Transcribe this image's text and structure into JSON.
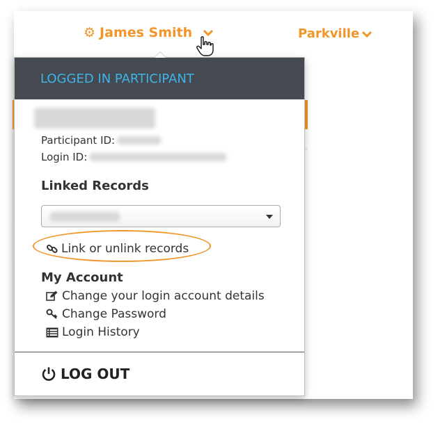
{
  "nav": {
    "user_name": "James Smith",
    "location": "Parkville"
  },
  "dropdown": {
    "header": "LOGGED IN PARTICIPANT",
    "participant_id_label": "Participant ID:",
    "login_id_label": "Login ID:",
    "linked_records_title": "Linked Records",
    "link_records_label": "Link or unlink records",
    "my_account_title": "My Account",
    "account_links": {
      "change_details": "Change your login account details",
      "change_password": "Change Password",
      "login_history": "Login History"
    },
    "logout_label": "LOG OUT"
  },
  "colors": {
    "accent": "#f0962a",
    "header_bg": "#454a52",
    "header_text": "#3fb4e5"
  },
  "icons": {
    "user_menu": "gear-icon",
    "link": "link-icon",
    "edit": "edit-icon",
    "password": "key-icon",
    "history": "list-icon",
    "logout": "power-icon"
  }
}
